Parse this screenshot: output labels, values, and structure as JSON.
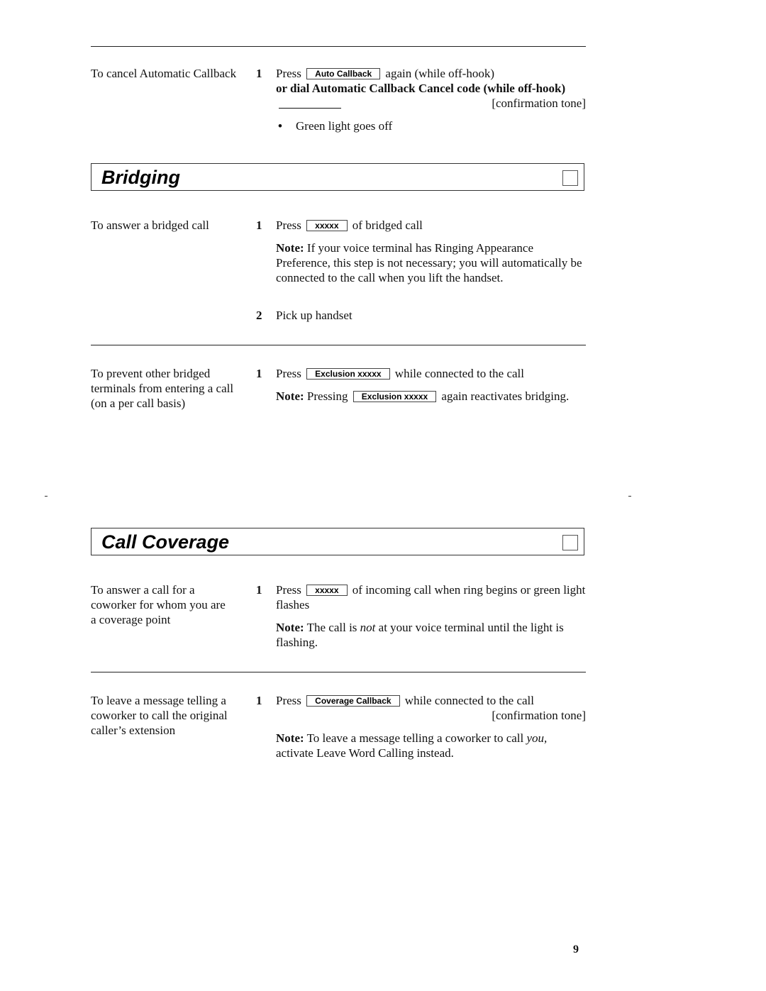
{
  "cancel_callback": {
    "task": "To cancel Automatic Callback",
    "step_number": "1",
    "press": "Press",
    "button": "Auto Callback",
    "after_button": "again (while off-hook)",
    "bold_line": "or dial Automatic Callback Cancel code (while off-hook)",
    "tone": "[confirmation tone]",
    "bullet": "Green light goes off"
  },
  "bridging": {
    "title": "Bridging",
    "answer": {
      "task": "To answer a bridged call",
      "step1_number": "1",
      "step1_press": "Press",
      "step1_button": "xxxxx",
      "step1_after": "of bridged call",
      "note_label": "Note:",
      "note_text": "If your voice terminal has Ringing Appearance Preference, this step is not necessary; you will automatically be connected to the call when you lift the handset.",
      "step2_number": "2",
      "step2_text": "Pick up handset"
    },
    "prevent": {
      "task": "To prevent other bridged terminals from entering a call (on a per call basis)",
      "step1_number": "1",
      "step1_press": "Press",
      "step1_button": "Exclusion xxxxx",
      "step1_after": "while connected to the call",
      "note_label": "Note:",
      "note_before": "Pressing",
      "note_button": "Exclusion xxxxx",
      "note_after": "again reactivates bridging."
    }
  },
  "call_coverage": {
    "title": "Call Coverage",
    "answer": {
      "task": "To answer a call for a coworker for whom you are a coverage point",
      "step1_number": "1",
      "step1_press": "Press",
      "step1_button": "xxxxx",
      "step1_after": "of incoming call when ring begins or green light flashes",
      "note_label": "Note:",
      "note_before": "The call is",
      "note_italic": "not",
      "note_after": "at your voice terminal until the light is flashing."
    },
    "leave_message": {
      "task": "To leave a message telling a coworker to call the original caller’s extension",
      "step1_number": "1",
      "step1_press": "Press",
      "step1_button": "Coverage Callback",
      "step1_after": "while connected to the call",
      "tone": "[confirmation tone]",
      "note_label": "Note:",
      "note_before": "To leave a message telling a coworker to call",
      "note_italic": "you,",
      "note_after": "activate Leave Word Calling instead."
    }
  },
  "page_number": "9"
}
